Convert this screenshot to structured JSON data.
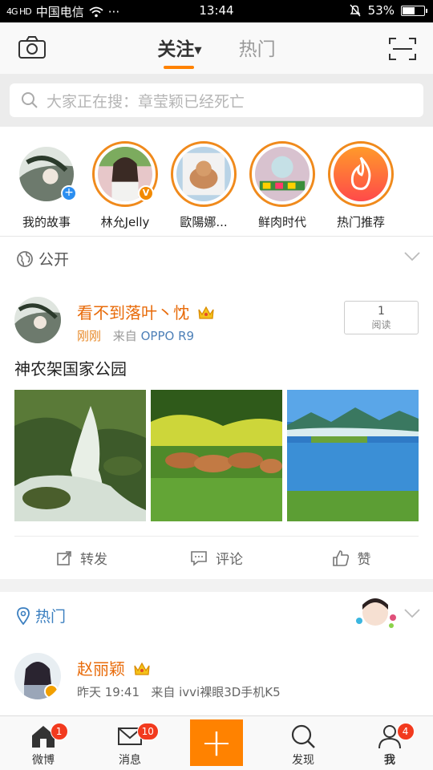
{
  "statusbar": {
    "signal_text": "4G HD",
    "carrier": "中国电信",
    "dots": "···",
    "time": "13:44",
    "battery": "53%",
    "battery_level": 0.53
  },
  "topnav": {
    "tabs": [
      {
        "label": "关注",
        "caret": "▼"
      },
      {
        "label": "热门"
      }
    ]
  },
  "search": {
    "placeholder": "大家正在搜：章莹颖已经死亡"
  },
  "stories": [
    {
      "name": "我的故事"
    },
    {
      "name": "林允Jelly"
    },
    {
      "name": "歐陽娜..."
    },
    {
      "name": "鲜肉时代"
    },
    {
      "name": "热门推荐"
    }
  ],
  "group": {
    "label": "公开"
  },
  "post": {
    "user": "看不到落叶丶忱",
    "time": "刚刚",
    "source_prefix": "来自",
    "source": "OPPO R9",
    "reads": "1",
    "reads_label": "阅读",
    "text": "神农架国家公园",
    "actions": {
      "repost": "转发",
      "comment": "评论",
      "like": "赞"
    }
  },
  "hot": {
    "label": "热门",
    "user": "赵丽颖",
    "time": "昨天 19:41",
    "source_prefix": "来自",
    "source": "ivvi裸眼3D手机K5"
  },
  "bottombar": {
    "items": [
      {
        "label": "微博",
        "badge": "1"
      },
      {
        "label": "消息",
        "badge": "10"
      },
      {
        "label": "+"
      },
      {
        "label": "发现"
      },
      {
        "label": "我",
        "badge": "4"
      }
    ]
  },
  "colors": {
    "accent": "#ff8200",
    "username": "#e86b0a",
    "link": "#4e80b8"
  }
}
